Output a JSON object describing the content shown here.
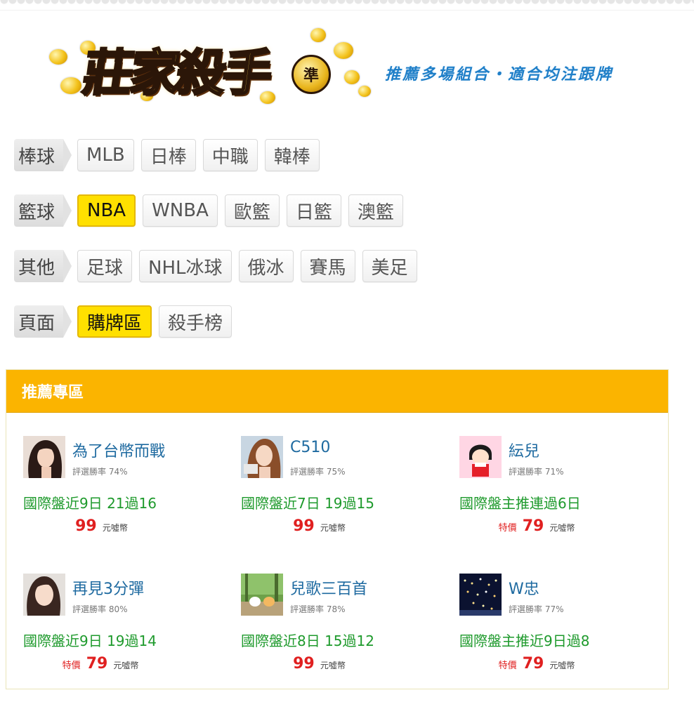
{
  "header": {
    "logo_text": "莊家殺手",
    "logo_badge": "準",
    "slogan": "推薦多場組合・適合均注跟牌"
  },
  "categories": [
    {
      "label": "棒球",
      "tabs": [
        {
          "label": "MLB",
          "active": false
        },
        {
          "label": "日棒",
          "active": false
        },
        {
          "label": "中職",
          "active": false
        },
        {
          "label": "韓棒",
          "active": false
        }
      ]
    },
    {
      "label": "籃球",
      "tabs": [
        {
          "label": "NBA",
          "active": true
        },
        {
          "label": "WNBA",
          "active": false
        },
        {
          "label": "歐籃",
          "active": false
        },
        {
          "label": "日籃",
          "active": false
        },
        {
          "label": "澳籃",
          "active": false
        }
      ]
    },
    {
      "label": "其他",
      "tabs": [
        {
          "label": "足球",
          "active": false
        },
        {
          "label": "NHL冰球",
          "active": false
        },
        {
          "label": "俄冰",
          "active": false
        },
        {
          "label": "賽馬",
          "active": false
        },
        {
          "label": "美足",
          "active": false
        }
      ]
    },
    {
      "label": "頁面",
      "tabs": [
        {
          "label": "購牌區",
          "active": true
        },
        {
          "label": "殺手榜",
          "active": false
        }
      ]
    }
  ],
  "recommend": {
    "title": "推薦專區",
    "cards": [
      {
        "name": "為了台幣而戰",
        "rate": "評選勝率 74%",
        "record": "國際盤近9日 21過16",
        "special": "",
        "price": "99",
        "unit": "元噓幣",
        "avatar": "woman-photo"
      },
      {
        "name": "C510",
        "rate": "評選勝率 75%",
        "record": "國際盤近7日 19過15",
        "special": "",
        "price": "99",
        "unit": "元噓幣",
        "avatar": "woman-photo"
      },
      {
        "name": "紜兒",
        "rate": "評選勝率 71%",
        "record": "國際盤主推連過6日",
        "special": "特價",
        "price": "79",
        "unit": "元噓幣",
        "avatar": "cartoon-girl"
      },
      {
        "name": "再見3分彈",
        "rate": "評選勝率 80%",
        "record": "國際盤近9日 19過14",
        "special": "特價",
        "price": "79",
        "unit": "元噓幣",
        "avatar": "woman-photo"
      },
      {
        "name": "兒歌三百首",
        "rate": "評選勝率 78%",
        "record": "國際盤近8日 15過12",
        "special": "",
        "price": "99",
        "unit": "元噓幣",
        "avatar": "forest-cartoon"
      },
      {
        "name": "W忠",
        "rate": "評選勝率 77%",
        "record": "國際盤主推近9日過8",
        "special": "特價",
        "price": "79",
        "unit": "元噓幣",
        "avatar": "night-lights"
      }
    ]
  }
}
